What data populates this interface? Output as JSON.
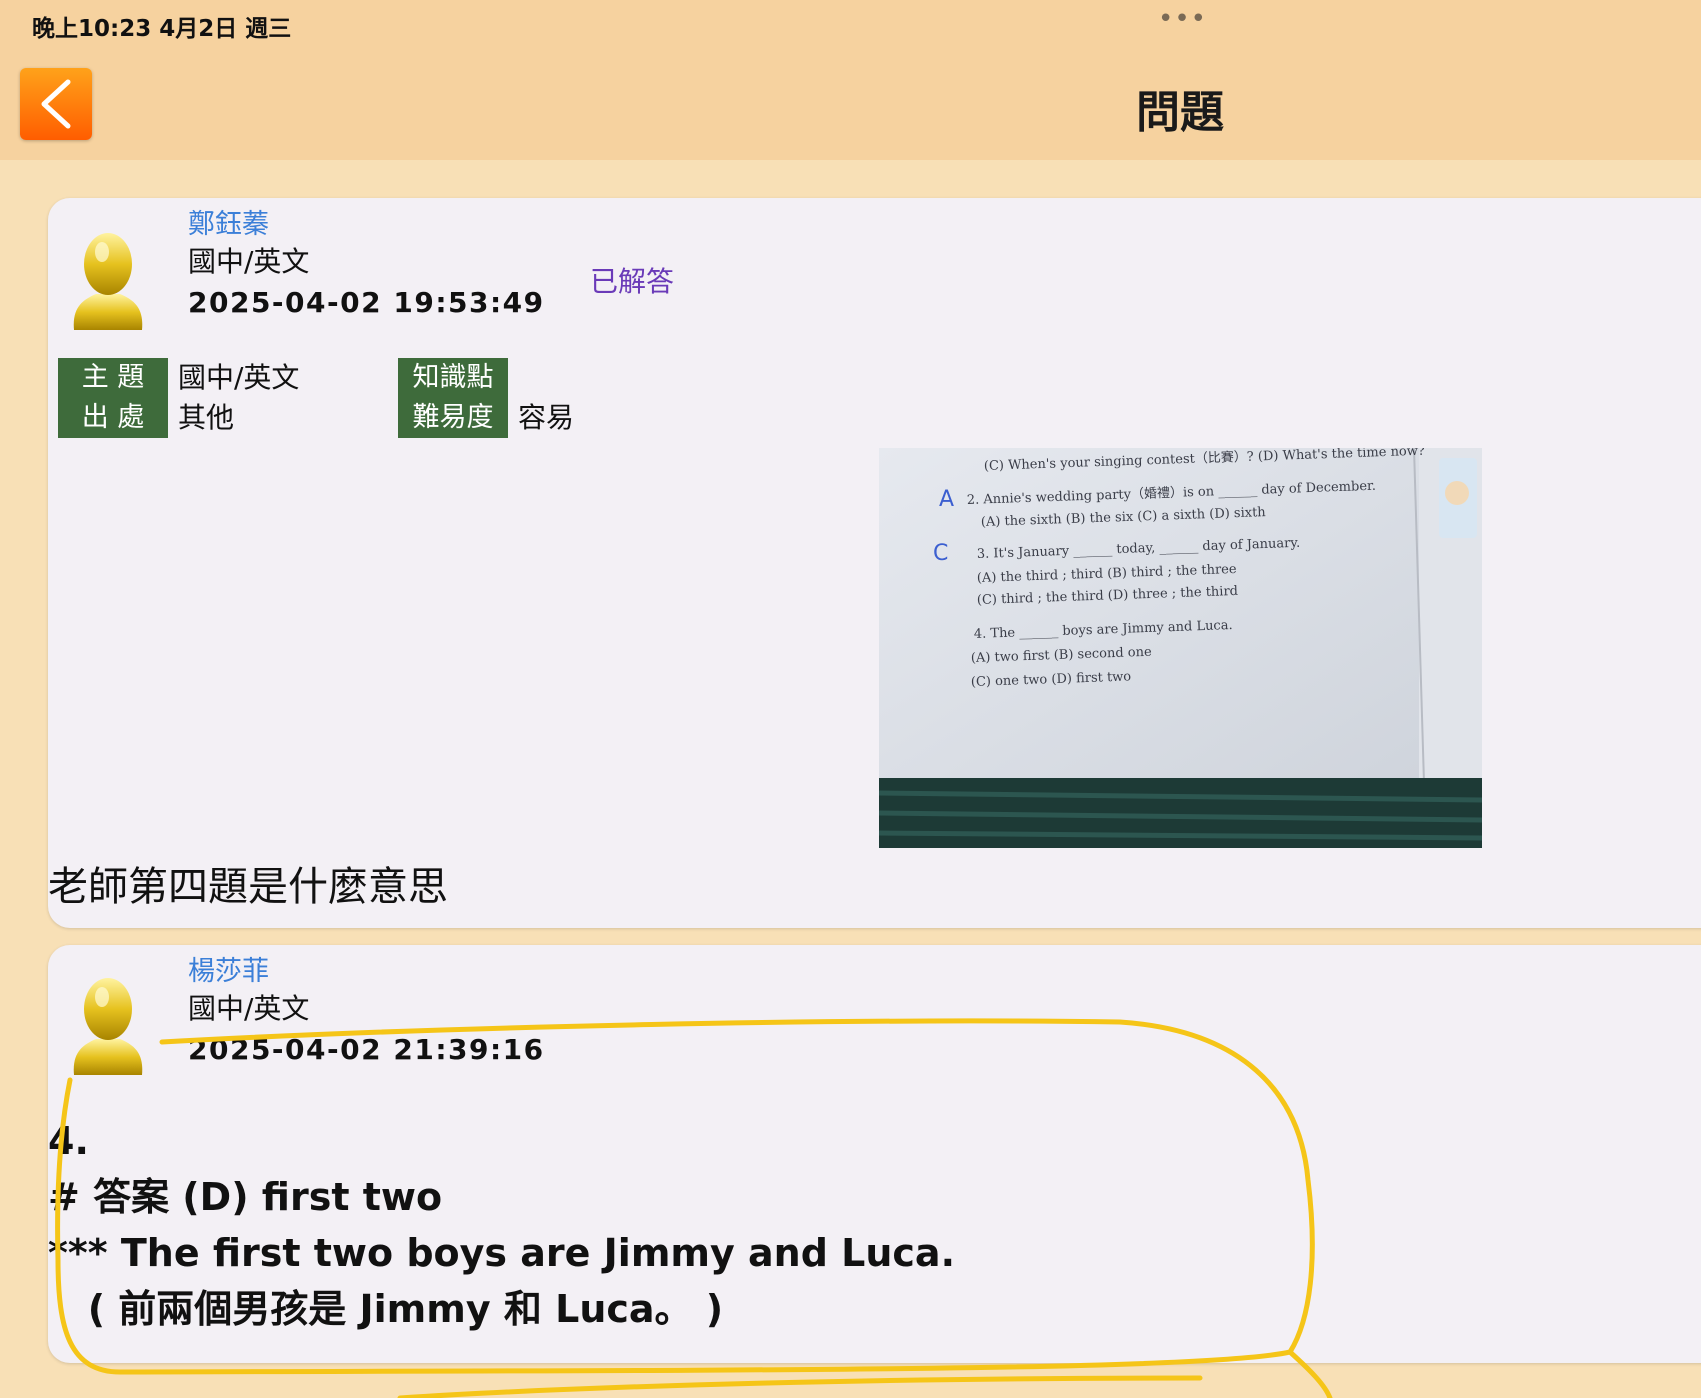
{
  "status_bar": {
    "time_date": "晚上10:23   4月2日 週三",
    "more": "•••"
  },
  "nav": {
    "title": "問題"
  },
  "question": {
    "author": "鄭鈺蓁",
    "subject": "國中/英文",
    "time": "2025-04-02 19:53:49",
    "status": "已解答",
    "meta": {
      "topic_label": "主 題",
      "topic_value": "國中/英文",
      "source_label": "出 處",
      "source_value": "其他",
      "knowledge_label": "知識點",
      "knowledge_value": "",
      "difficulty_label": "難易度",
      "difficulty_value": "容易"
    },
    "photo": {
      "lines": [
        "(C) When's your singing contest（比賽）? (D) What's the time now?",
        "2. Annie's wedding party（婚禮）is on ______ day of December.",
        "(A) the sixth        (B) the six        (C) a sixth        (D) sixth",
        "3. It's January ______ today, ______ day of January.",
        "(A) the third ; third        (B) third ; the three",
        "(C) third ; the third        (D) three ; the third",
        "4. The ______ boys are Jimmy and Luca.",
        "(A) two first        (B) second one",
        "(C) one two          (D) first two"
      ],
      "answers": [
        "A",
        "C"
      ]
    },
    "text": "老師第四題是什麼意思"
  },
  "answer": {
    "author": "楊莎菲",
    "subject": "國中/英文",
    "time": "2025-04-02 21:39:16",
    "lines": [
      "4.",
      "# 答案 (D) first two",
      "*** The first two boys are Jimmy and Luca.",
      "   ( 前兩個男孩是 Jimmy 和 Luca。 )"
    ]
  },
  "colors": {
    "header": "#f6d29f",
    "background": "#f8e0b6",
    "card": "#f3f0f5",
    "name_blue": "#3b7fd8",
    "answered_purple": "#6a3ab8",
    "label_green": "#3e6b3b",
    "highlight_yellow": "#f5c518"
  }
}
